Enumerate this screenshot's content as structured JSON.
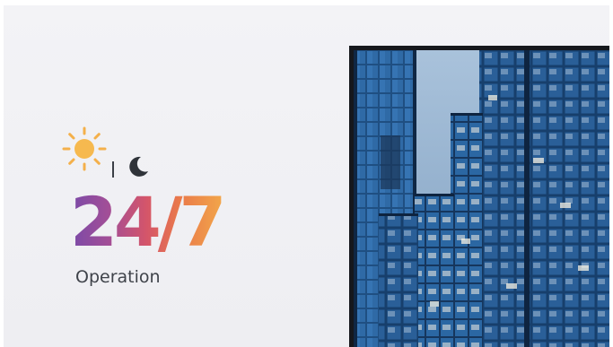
{
  "slide": {
    "headline": "24/7",
    "subheadline": "Operation"
  },
  "icons": {
    "day": "sun-icon",
    "night": "moon-icon"
  },
  "colors": {
    "gradient_start": "#7a4aa8",
    "gradient_mid": "#d4556a",
    "gradient_end": "#f2a64a",
    "sun": "#f4b04a",
    "moon": "#2f3339",
    "text": "#3f434a",
    "background": "#f1f1f4",
    "frame": "#16181d"
  }
}
